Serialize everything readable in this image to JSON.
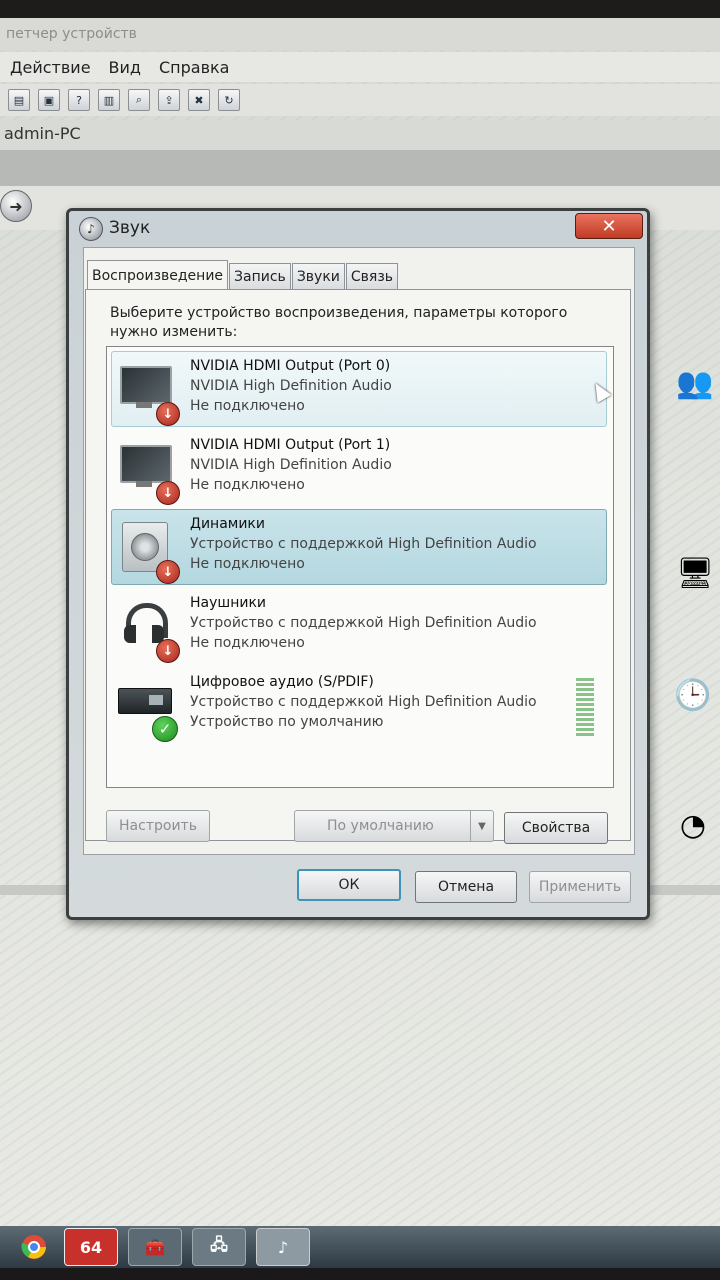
{
  "background": {
    "window_title": "петчер устройств",
    "menu": [
      "Действие",
      "Вид",
      "Справка"
    ],
    "computer_name": "admin-PC"
  },
  "dialog": {
    "title": "Звук",
    "close_label": "✕",
    "tabs": [
      {
        "label": "Воспроизведение",
        "active": true
      },
      {
        "label": "Запись",
        "active": false
      },
      {
        "label": "Звуки",
        "active": false
      },
      {
        "label": "Связь",
        "active": false
      }
    ],
    "instruction": "Выберите устройство воспроизведения, параметры которого нужно изменить:",
    "devices": [
      {
        "name": "NVIDIA HDMI Output (Port 0)",
        "driver": "NVIDIA High Definition Audio",
        "status": "Не подключено",
        "icon": "monitor-icon",
        "badge": "disconnected",
        "state": "hover"
      },
      {
        "name": "NVIDIA HDMI Output (Port 1)",
        "driver": "NVIDIA High Definition Audio",
        "status": "Не подключено",
        "icon": "monitor-icon",
        "badge": "disconnected",
        "state": "normal"
      },
      {
        "name": "Динамики",
        "driver": "Устройство с поддержкой High Definition Audio",
        "status": "Не подключено",
        "icon": "speaker-icon",
        "badge": "disconnected",
        "state": "selected"
      },
      {
        "name": "Наушники",
        "driver": "Устройство с поддержкой High Definition Audio",
        "status": "Не подключено",
        "icon": "headphones-icon",
        "badge": "disconnected",
        "state": "normal"
      },
      {
        "name": "Цифровое аудио (S/PDIF)",
        "driver": "Устройство с поддержкой High Definition Audio",
        "status": "Устройство по умолчанию",
        "icon": "digital-audio-icon",
        "badge": "default",
        "state": "normal"
      }
    ],
    "buttons": {
      "configure": "Настроить",
      "set_default": "По умолчанию",
      "properties": "Свойства",
      "ok": "ОК",
      "cancel": "Отмена",
      "apply": "Применить"
    }
  },
  "taskbar": {
    "aida_label": "64"
  },
  "colors": {
    "selected_row": "#b4d7e0",
    "close_button": "#c03b24",
    "default_badge": "#1d8a1f",
    "disconnected_badge": "#a9261c"
  }
}
